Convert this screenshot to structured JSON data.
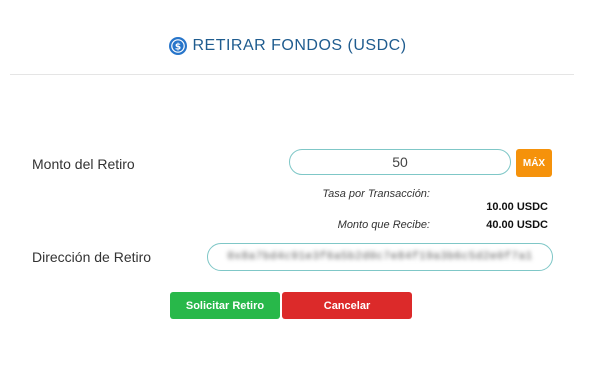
{
  "header": {
    "title": "RETIRAR FONDOS (USDC)",
    "icon": "usdc-coin-icon",
    "title_color": "#1f5c8f"
  },
  "form": {
    "amount_label": "Monto del Retiro",
    "amount_value": "50",
    "max_label": "MÁX",
    "fee_label": "Tasa por Transacción:",
    "fee_value": "10.00 USDC",
    "receive_label": "Monto que Recibe:",
    "receive_value": "40.00 USDC",
    "address_label": "Dirección de Retiro",
    "address_value": "0x8a7bd4c91e3f6a5b2d0c7e84f19a3b6c5d2e0f7a1"
  },
  "actions": {
    "submit_label": "Solicitar Retiro",
    "cancel_label": "Cancelar",
    "submit_color": "#28b84a",
    "cancel_color": "#dc2a2a",
    "max_color": "#f5920b"
  }
}
